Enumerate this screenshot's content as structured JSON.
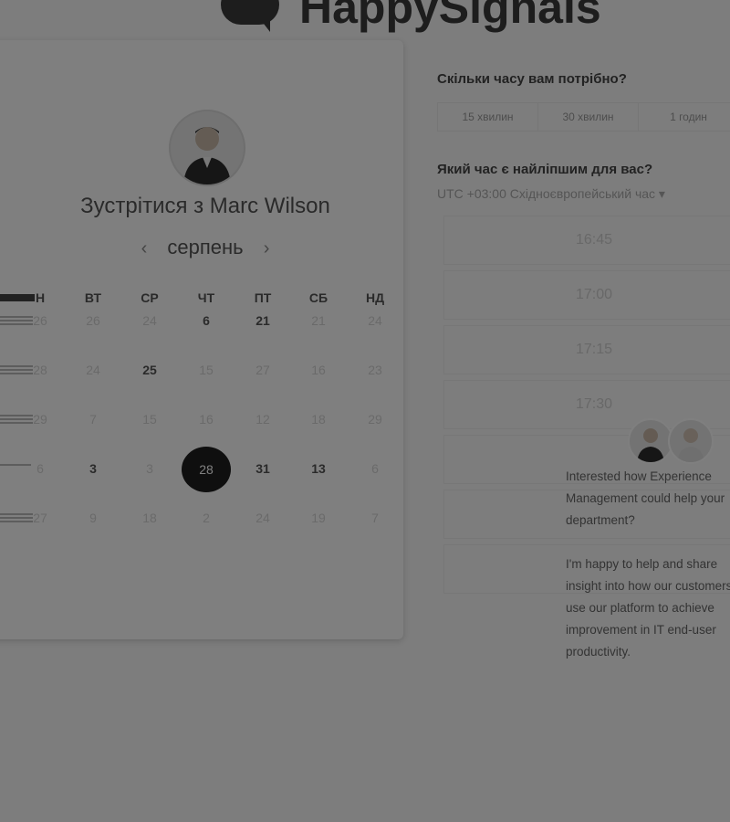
{
  "brand": {
    "name": "HappySignals"
  },
  "host": {
    "title": "Зустрітися з Marc Wilson"
  },
  "calendar": {
    "month": "серпень",
    "prev_icon": "chevron-left-icon",
    "next_icon": "chevron-right-icon",
    "weekdays": [
      "ВТ",
      "СР",
      "ЧТ",
      "ПТ",
      "СБ",
      "НД"
    ],
    "first_weekday_partial": "Н",
    "rows": [
      {
        "first": "26",
        "days": [
          {
            "d": "26",
            "s": "dim"
          },
          {
            "d": "24",
            "s": "dim"
          },
          {
            "d": "6",
            "s": "bold"
          },
          {
            "d": "21",
            "s": "bold"
          },
          {
            "d": "21",
            "s": "dim"
          },
          {
            "d": "24",
            "s": "dim"
          }
        ]
      },
      {
        "first": "28",
        "days": [
          {
            "d": "24",
            "s": "dim"
          },
          {
            "d": "25",
            "s": "bold"
          },
          {
            "d": "15",
            "s": "dim"
          },
          {
            "d": "27",
            "s": "dim"
          },
          {
            "d": "16",
            "s": "dim"
          },
          {
            "d": "23",
            "s": "dim"
          }
        ]
      },
      {
        "first": "29",
        "days": [
          {
            "d": "7",
            "s": "dim"
          },
          {
            "d": "15",
            "s": "dim"
          },
          {
            "d": "16",
            "s": "dim"
          },
          {
            "d": "12",
            "s": "dim"
          },
          {
            "d": "18",
            "s": "dim"
          },
          {
            "d": "29",
            "s": "dim"
          }
        ]
      },
      {
        "first": "6",
        "days": [
          {
            "d": "3",
            "s": "bold"
          },
          {
            "d": "3",
            "s": "dim"
          },
          {
            "d": "28",
            "s": "circ"
          },
          {
            "d": "31",
            "s": "bold"
          },
          {
            "d": "13",
            "s": "bold"
          },
          {
            "d": "6",
            "s": "dim"
          }
        ]
      },
      {
        "first": "27",
        "days": [
          {
            "d": "9",
            "s": "dim"
          },
          {
            "d": "18",
            "s": "dim"
          },
          {
            "d": "2",
            "s": "dim"
          },
          {
            "d": "24",
            "s": "dim"
          },
          {
            "d": "19",
            "s": "dim"
          },
          {
            "d": "7",
            "s": "dim"
          }
        ]
      }
    ]
  },
  "duration": {
    "question": "Скільки часу вам потрібно?",
    "options": [
      "15 хвилин",
      "30 хвилин",
      "1 годин"
    ]
  },
  "time": {
    "question": "Який час є найліпшим для вас?",
    "timezone": "UTC +03:00 Східноєвропейський час ▾",
    "slots": [
      "16:45",
      "17:00",
      "17:15",
      "17:30",
      "",
      "",
      ""
    ]
  },
  "chat": {
    "message_1": "Interested how Experience Management could help your department?",
    "message_2": "I'm happy to help and share insight into how our customers use our platform to achieve improvement in IT end-user productivity."
  }
}
